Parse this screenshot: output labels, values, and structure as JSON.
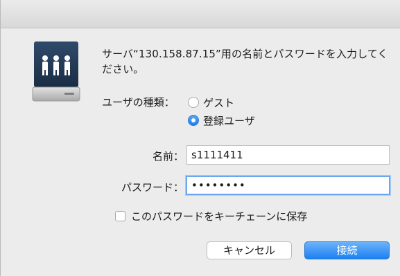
{
  "dialog": {
    "prompt": "サーバ“130.158.87.15”用の名前とパスワードを入力してください。"
  },
  "user_kind": {
    "label": "ユーザの種類：",
    "options": [
      {
        "label": "ゲスト",
        "selected": false
      },
      {
        "label": "登録ユーザ",
        "selected": true
      }
    ]
  },
  "fields": {
    "name_label": "名前：",
    "name_value": "s1111411",
    "password_label": "パスワード：",
    "password_mask": "••••••••"
  },
  "keychain": {
    "label": "このパスワードをキーチェーンに保存",
    "checked": false
  },
  "buttons": {
    "cancel": "キャンセル",
    "connect": "接続"
  },
  "colors": {
    "accent": "#1d80f1",
    "window_bg": "#ececec"
  },
  "icons": {
    "server": "shared-server-icon"
  }
}
